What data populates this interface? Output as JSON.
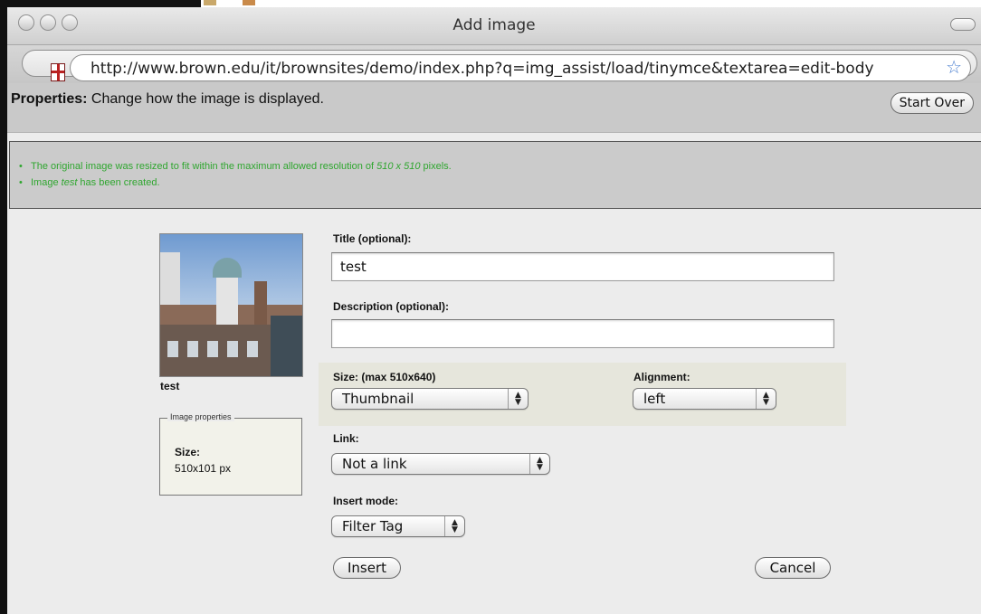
{
  "window": {
    "title": "Add image",
    "url": "http://www.brown.edu/it/brownsites/demo/index.php?q=img_assist/load/tinymce&textarea=edit-body"
  },
  "header": {
    "title": "Properties:",
    "subtitle": "Change how the image is displayed.",
    "start_over_label": "Start Over"
  },
  "messages": [
    {
      "pre": "The original image was resized to fit within the maximum allowed resolution of ",
      "em": "510 x 510",
      "post": " pixels."
    },
    {
      "pre": "Image ",
      "em": "test",
      "post": " has been created."
    }
  ],
  "thumbnail": {
    "caption": "test"
  },
  "image_properties": {
    "legend": "Image properties",
    "size_label": "Size:",
    "size_value": "510x101 px"
  },
  "form": {
    "title_label": "Title (optional):",
    "title_value": "test",
    "description_label": "Description (optional):",
    "description_value": "",
    "size_label": "Size: (max 510x640)",
    "size_value": "Thumbnail",
    "alignment_label": "Alignment:",
    "alignment_value": "left",
    "link_label": "Link:",
    "link_value": "Not a link",
    "insert_mode_label": "Insert mode:",
    "insert_mode_value": "Filter Tag",
    "insert_label": "Insert",
    "cancel_label": "Cancel"
  },
  "icons": {
    "star": "☆",
    "select_arrows": "▲▼"
  }
}
